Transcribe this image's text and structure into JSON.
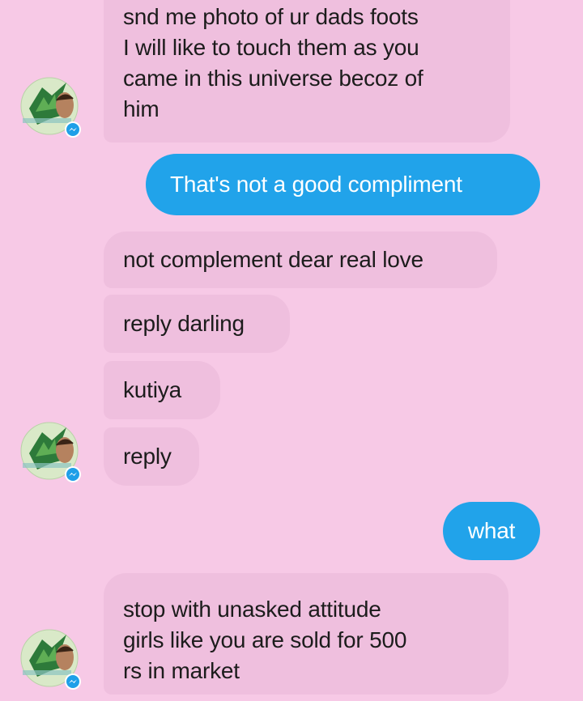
{
  "chat": {
    "messages": [
      {
        "sender": "them",
        "text": "snd me photo of ur dads foots\nI will like to touch them as you\ncame in this universe becoz of\nhim"
      },
      {
        "sender": "me",
        "text": "That's not a good compliment"
      },
      {
        "sender": "them",
        "text": "not complement dear real love"
      },
      {
        "sender": "them",
        "text": "reply darling"
      },
      {
        "sender": "them",
        "text": "kutiya"
      },
      {
        "sender": "them",
        "text": "reply"
      },
      {
        "sender": "me",
        "text": "what"
      },
      {
        "sender": "them",
        "text": "stop with unasked attitude\ngirls like you are sold for 500\nrs in market"
      }
    ]
  },
  "avatar": {
    "icon": "contact-avatar-icon",
    "badge_icon": "messenger-badge-icon"
  },
  "colors": {
    "background": "#f7c9e6",
    "incoming_bubble": "#efbfde",
    "outgoing_bubble": "#21a3ea",
    "incoming_text": "#1c1c1c",
    "outgoing_text": "#ffffff"
  }
}
